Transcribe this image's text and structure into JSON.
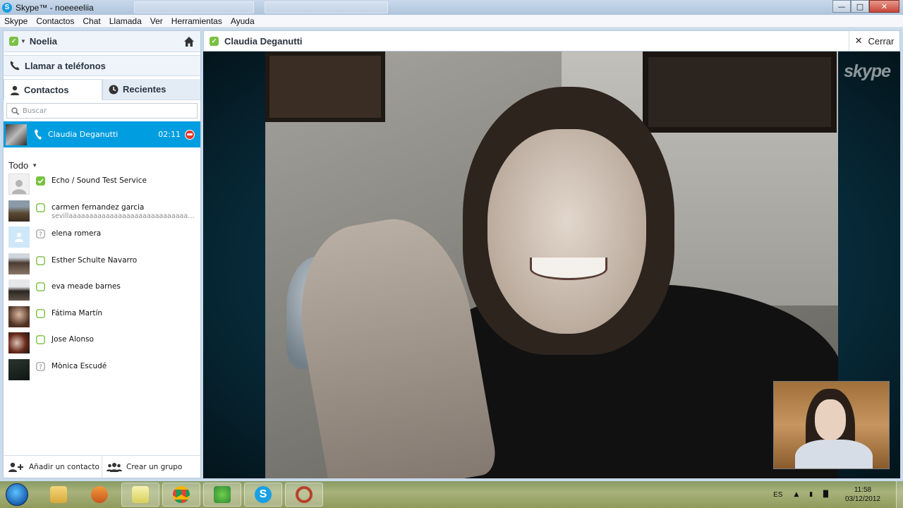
{
  "window": {
    "title": "Skype™ - noeeeeliia"
  },
  "menu": [
    "Skype",
    "Contactos",
    "Chat",
    "Llamada",
    "Ver",
    "Herramientas",
    "Ayuda"
  ],
  "sidebar": {
    "user_name": "Noelia",
    "call_phones_label": "Llamar a teléfonos",
    "tabs": [
      {
        "label": "Contactos",
        "active": true
      },
      {
        "label": "Recientes",
        "active": false
      }
    ],
    "search_placeholder": "Buscar",
    "active_call": {
      "name": "Claudia Deganutti",
      "duration": "02:11"
    },
    "group_label": "Todo",
    "contacts": [
      {
        "name": "Echo / Sound Test Service",
        "mood": "",
        "status": "online",
        "avatar": "generic-gray"
      },
      {
        "name": "carmen  fernandez garcia",
        "mood": "sevillaaaaaaaaaaaaaaaaaaaaaaaaaaaaaaaaaaaaaaaaaaaaaaa",
        "status": "offline",
        "avatar": "photo"
      },
      {
        "name": "elena romera",
        "mood": "",
        "status": "unknown",
        "avatar": "generic-blue"
      },
      {
        "name": "Esther Schulte Navarro",
        "mood": "",
        "status": "offline",
        "avatar": "photo"
      },
      {
        "name": "eva meade barnes",
        "mood": "",
        "status": "offline",
        "avatar": "photo"
      },
      {
        "name": "Fátima Martín",
        "mood": "",
        "status": "offline",
        "avatar": "photo"
      },
      {
        "name": "Jose Alonso",
        "mood": "",
        "status": "offline",
        "avatar": "photo"
      },
      {
        "name": "Mònica Escudé",
        "mood": "",
        "status": "unknown",
        "avatar": "photo"
      }
    ],
    "footer": {
      "add_contact": "Añadir un contacto",
      "create_group": "Crear un grupo"
    }
  },
  "conversation": {
    "contact_name": "Claudia Deganutti",
    "close_label": "Cerrar",
    "watermark": "skype"
  },
  "taskbar": {
    "language": "ES",
    "time": "11:58",
    "date": "03/12/2012"
  },
  "colors": {
    "accent": "#009de0",
    "online": "#7ac142",
    "hangup": "#e5352b"
  }
}
